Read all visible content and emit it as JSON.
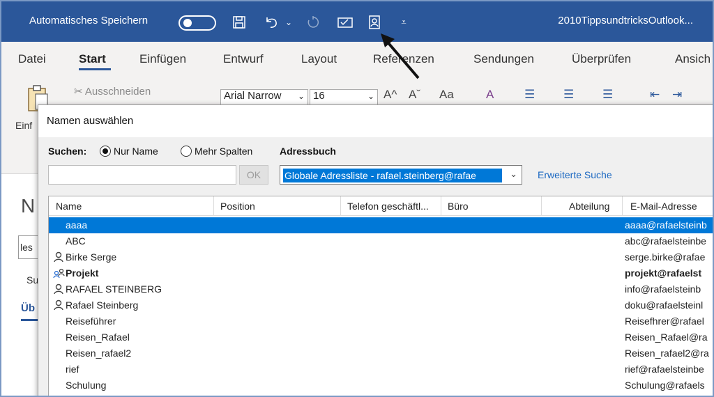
{
  "titlebar": {
    "autosave_label": "Automatisches Speichern",
    "document_title": "2010TippsundtricksOutlook..."
  },
  "tabs": [
    "Datei",
    "Start",
    "Einfügen",
    "Entwurf",
    "Layout",
    "Referenzen",
    "Sendungen",
    "Überprüfen",
    "Ansich"
  ],
  "ribbon": {
    "cut_label": "Ausschneiden",
    "font_name": "Arial Narrow",
    "font_size": "16",
    "paste_label": "Einf",
    "font_grow": "A^",
    "font_shrink": "Aˇ",
    "change_case": "Aa",
    "clear_format": "A"
  },
  "background": {
    "heading_letter": "N",
    "field_text": "les",
    "sub_text": "Su",
    "tab_text": "Üb"
  },
  "dialog": {
    "title": "Namen auswählen",
    "search_label": "Suchen:",
    "radio_name_only": "Nur Name",
    "radio_more_columns": "Mehr Spalten",
    "addressbook_label": "Adressbuch",
    "search_value": "",
    "ok_label": "OK",
    "addressbook_value": "Globale Adressliste - rafael.steinberg@rafae",
    "advanced_search": "Erweiterte Suche",
    "columns": [
      "Name",
      "Position",
      "Telefon geschäftl...",
      "Büro",
      "Abteilung",
      "E-Mail-Adresse"
    ],
    "rows": [
      {
        "name": "aaaa",
        "email": "aaaa@rafaelsteinb",
        "icon": "none",
        "selected": true,
        "bold": false
      },
      {
        "name": "ABC",
        "email": "abc@rafaelsteinbe",
        "icon": "none",
        "selected": false,
        "bold": false
      },
      {
        "name": "Birke Serge",
        "email": "serge.birke@rafae",
        "icon": "person-icon",
        "selected": false,
        "bold": false
      },
      {
        "name": "Projekt",
        "email": "projekt@rafaelst",
        "icon": "group-icon",
        "selected": false,
        "bold": true
      },
      {
        "name": "RAFAEL STEINBERG",
        "email": "info@rafaelsteinb",
        "icon": "person-icon",
        "selected": false,
        "bold": false
      },
      {
        "name": "Rafael Steinberg",
        "email": "doku@rafaelsteinl",
        "icon": "person-icon",
        "selected": false,
        "bold": false
      },
      {
        "name": "Reiseführer",
        "email": "Reisefhrer@rafael",
        "icon": "none",
        "selected": false,
        "bold": false
      },
      {
        "name": "Reisen_Rafael",
        "email": "Reisen_Rafael@ra",
        "icon": "none",
        "selected": false,
        "bold": false
      },
      {
        "name": "Reisen_rafael2",
        "email": "Reisen_rafael2@ra",
        "icon": "none",
        "selected": false,
        "bold": false
      },
      {
        "name": "rief",
        "email": "rief@rafaelsteinbe",
        "icon": "none",
        "selected": false,
        "bold": false
      },
      {
        "name": "Schulung",
        "email": "Schulung@rafaels",
        "icon": "none",
        "selected": false,
        "bold": false
      }
    ]
  },
  "colors": {
    "titlebar": "#2b579a",
    "selection": "#0078d7",
    "link": "#1a67c1"
  }
}
